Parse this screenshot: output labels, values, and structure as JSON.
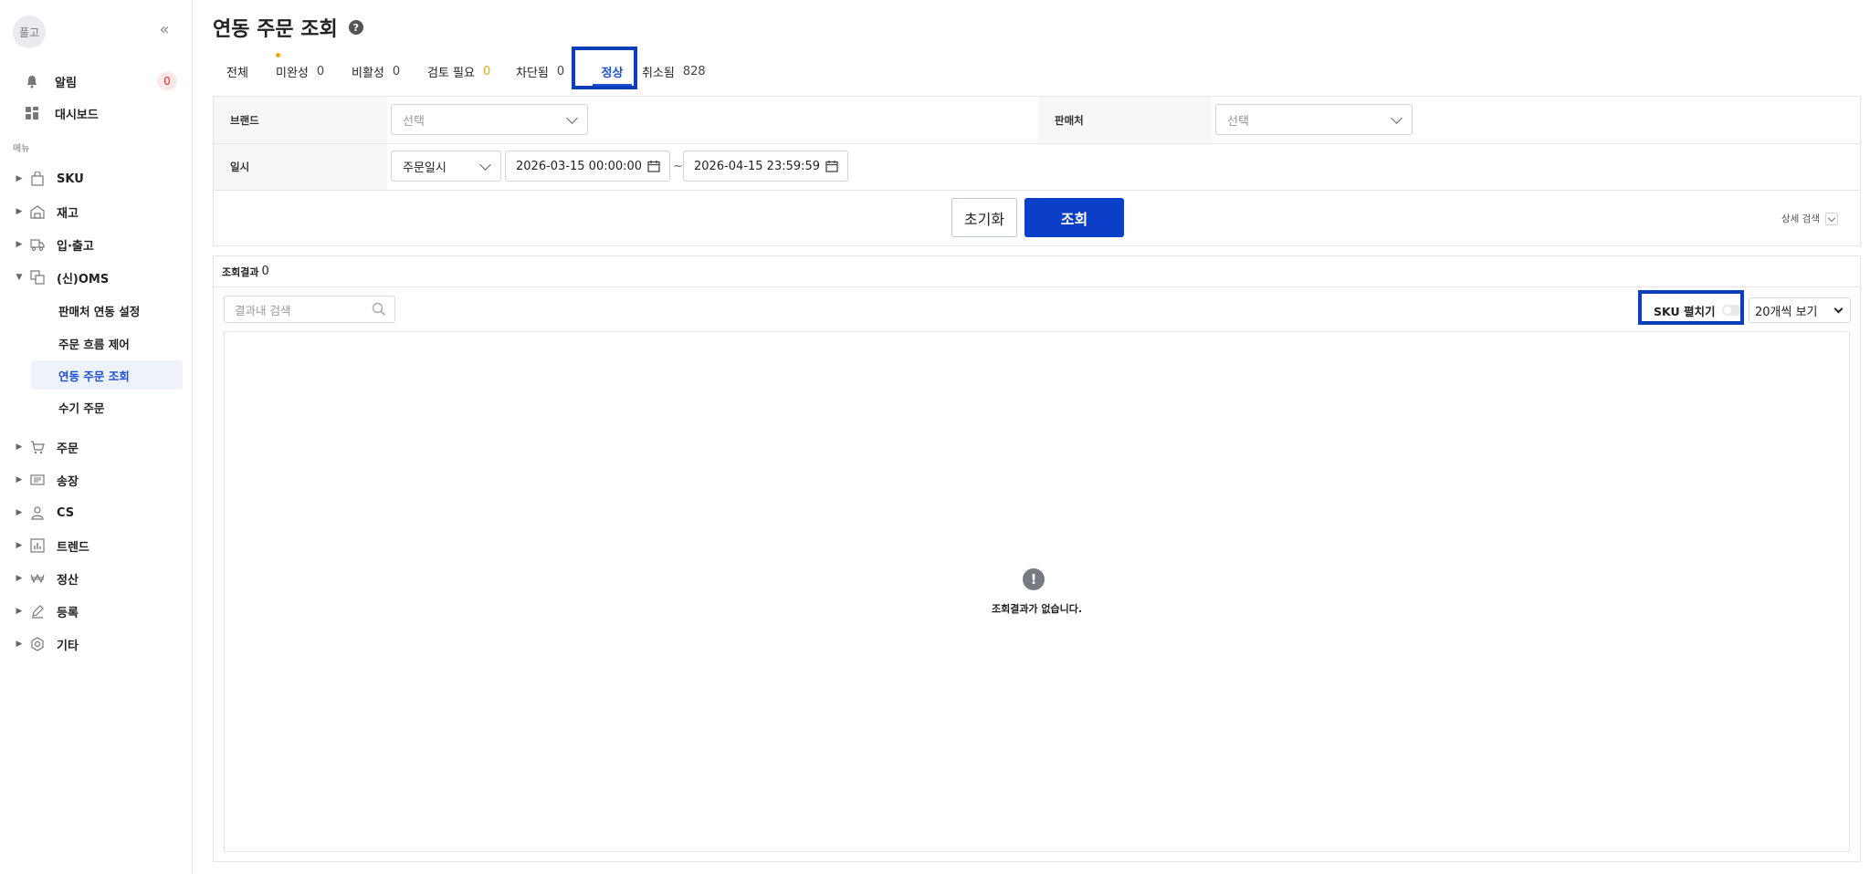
{
  "sidebar": {
    "avatar_text": "풀고",
    "collapse_icon": "double-chevron-left-icon",
    "top_items": [
      {
        "label": "알림",
        "icon": "bell-icon",
        "badge": "0"
      },
      {
        "label": "대시보드",
        "icon": "dashboard-icon"
      }
    ],
    "menu_caption": "메뉴",
    "nav": [
      {
        "label": "SKU",
        "icon": "bag-icon"
      },
      {
        "label": "재고",
        "icon": "warehouse-icon"
      },
      {
        "label": "입·출고",
        "icon": "truck-icon"
      },
      {
        "label": "(신)OMS",
        "icon": "oms-icon",
        "expanded": true
      },
      {
        "label": "주문",
        "icon": "cart-icon"
      },
      {
        "label": "송장",
        "icon": "invoice-icon"
      },
      {
        "label": "CS",
        "icon": "person-icon"
      },
      {
        "label": "트렌드",
        "icon": "chart-icon"
      },
      {
        "label": "정산",
        "icon": "won-icon"
      },
      {
        "label": "등록",
        "icon": "pencil-icon"
      },
      {
        "label": "기타",
        "icon": "settings-icon"
      }
    ],
    "oms_sub": [
      {
        "label": "판매처 연동 설정"
      },
      {
        "label": "주문 흐름 제어"
      },
      {
        "label": "연동 주문 조회",
        "active": true
      },
      {
        "label": "수기 주문"
      }
    ]
  },
  "page": {
    "title": "연동 주문 조회",
    "help_icon": "help-icon"
  },
  "tabs": [
    {
      "label": "전체",
      "count": ""
    },
    {
      "label": "미완성",
      "count": "0"
    },
    {
      "label": "비활성",
      "count": "0"
    },
    {
      "label": "검토 필요",
      "count": "0"
    },
    {
      "label": "차단됨",
      "count": "0"
    },
    {
      "label": "정상",
      "count": "",
      "active": true
    },
    {
      "label": "취소됨",
      "count": "828"
    }
  ],
  "filters": {
    "brand_label": "브랜드",
    "brand_placeholder": "선택",
    "seller_label": "판매처",
    "seller_placeholder": "선택",
    "date_label": "일시",
    "date_type": "주문일시",
    "date_from": "2026-03-15 00:00:00",
    "date_sep": "~",
    "date_to": "2026-04-15 23:59:59",
    "reset_label": "초기화",
    "search_label": "조회",
    "advanced_label": "상세 검색"
  },
  "results": {
    "label": "조회결과",
    "count": "0",
    "inner_search_placeholder": "결과내 검색",
    "sku_toggle_label": "SKU 펼치기",
    "sku_toggle_on": false,
    "page_size": "20개씩 보기",
    "empty_message": "조회결과가 없습니다."
  },
  "colors": {
    "primary": "#0b3fc7",
    "highlight": "#0a3fb8",
    "warning": "#f2a51b",
    "alert": "#e03131"
  }
}
